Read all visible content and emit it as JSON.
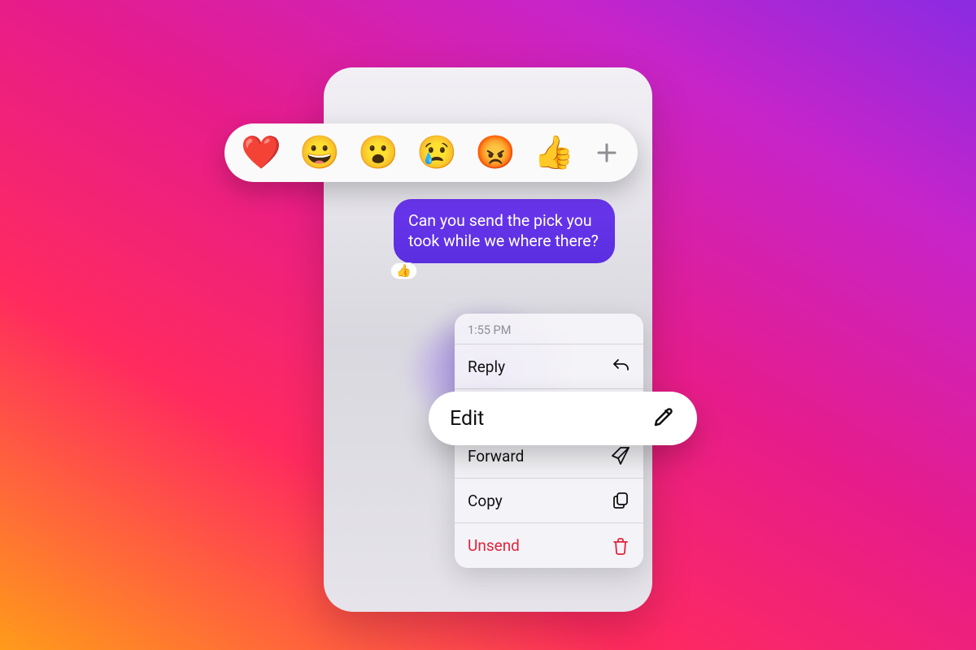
{
  "message": {
    "text": "Can you send the pick you took while we where there?",
    "reaction_emoji": "👍"
  },
  "reactions": {
    "emojis": [
      "❤️",
      "😀",
      "😮",
      "😢",
      "😡",
      "👍"
    ]
  },
  "context_menu": {
    "timestamp": "1:55 PM",
    "items": {
      "reply": "Reply",
      "edit": "Edit",
      "forward": "Forward",
      "copy": "Copy",
      "unsend": "Unsend"
    }
  }
}
